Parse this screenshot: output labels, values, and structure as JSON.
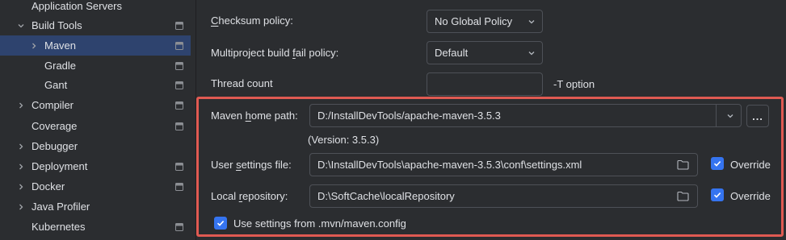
{
  "sidebar": {
    "items": [
      {
        "label": "Application Servers",
        "expandable": false,
        "project_icon": false,
        "selected": false
      },
      {
        "label": "Build Tools",
        "expandable": true,
        "expanded": true,
        "project_icon": true,
        "selected": false
      },
      {
        "label": "Maven",
        "expandable": true,
        "expanded": false,
        "project_icon": true,
        "selected": true
      },
      {
        "label": "Gradle",
        "expandable": false,
        "project_icon": true,
        "selected": false
      },
      {
        "label": "Gant",
        "expandable": false,
        "project_icon": true,
        "selected": false
      },
      {
        "label": "Compiler",
        "expandable": true,
        "expanded": false,
        "project_icon": true,
        "selected": false
      },
      {
        "label": "Coverage",
        "expandable": false,
        "project_icon": true,
        "selected": false
      },
      {
        "label": "Debugger",
        "expandable": true,
        "expanded": false,
        "project_icon": false,
        "selected": false
      },
      {
        "label": "Deployment",
        "expandable": true,
        "expanded": false,
        "project_icon": true,
        "selected": false
      },
      {
        "label": "Docker",
        "expandable": true,
        "expanded": false,
        "project_icon": true,
        "selected": false
      },
      {
        "label": "Java Profiler",
        "expandable": true,
        "expanded": false,
        "project_icon": false,
        "selected": false
      },
      {
        "label": "Kubernetes",
        "expandable": false,
        "project_icon": true,
        "selected": false
      }
    ]
  },
  "settings": {
    "checksum_policy": {
      "label_pre": "",
      "mnemonic": "C",
      "label_post": "hecksum policy:",
      "value": "No Global Policy"
    },
    "multiproject_policy": {
      "label_pre": "Multiproject build ",
      "mnemonic": "f",
      "label_post": "ail policy:",
      "value": "Default"
    },
    "thread_count": {
      "label": "Thread count",
      "value": "",
      "hint": "-T option"
    },
    "maven_home": {
      "label_pre": "Maven ",
      "mnemonic": "h",
      "label_post": "ome path:",
      "value": "D:/InstallDevTools/apache-maven-3.5.3",
      "browse_label": "...",
      "version": "(Version: 3.5.3)"
    },
    "user_settings": {
      "label_pre": "User ",
      "mnemonic": "s",
      "label_post": "ettings file:",
      "value": "D:\\InstallDevTools\\apache-maven-3.5.3\\conf\\settings.xml",
      "override_label": "Override",
      "override_checked": true
    },
    "local_repo": {
      "label_pre": "Local ",
      "mnemonic": "r",
      "label_post": "epository:",
      "value": "D:\\SoftCache\\localRepository",
      "override_label": "Override",
      "override_checked": true
    },
    "mvn_config": {
      "label": "Use settings from .mvn/maven.config",
      "checked": true
    }
  },
  "colors": {
    "background": "#2b2d30",
    "selection": "#2e436e",
    "highlight_border": "#e05a52",
    "checkbox_accent": "#3574f0",
    "text": "#dfe1e5"
  },
  "icons": {
    "collapsed": "chevron-right-icon",
    "expanded": "chevron-down-icon",
    "project_level": "project-scope-icon",
    "dropdown": "chevron-down-icon",
    "browse": "folder-icon",
    "check": "check-icon"
  }
}
